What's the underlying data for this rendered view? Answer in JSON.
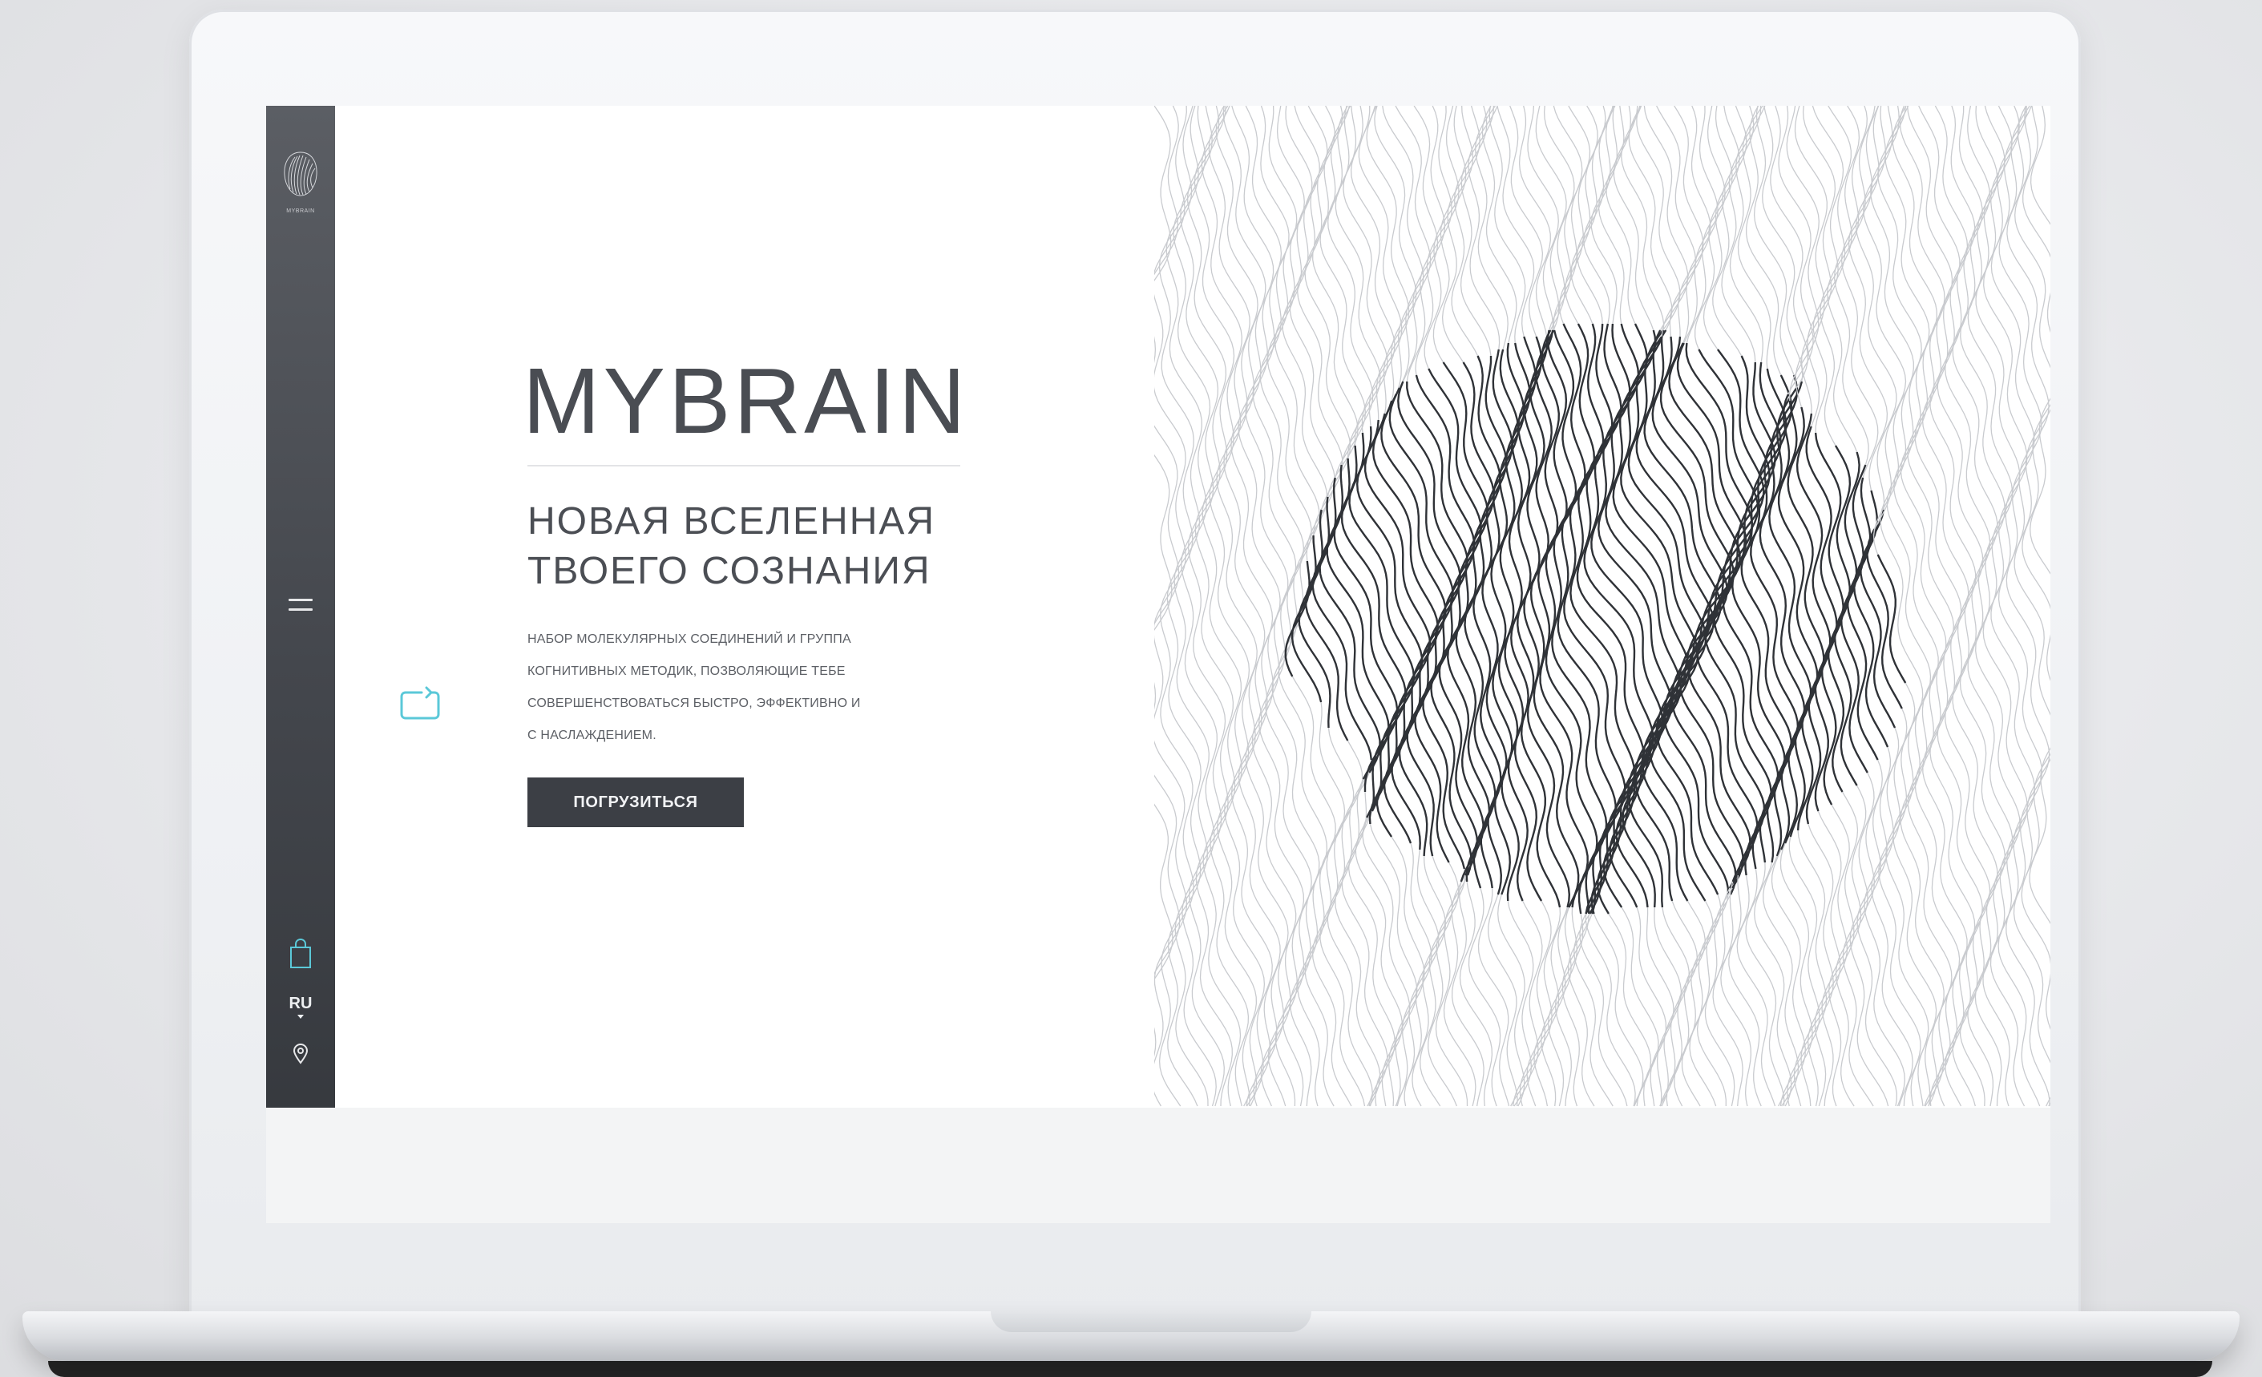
{
  "sidebar": {
    "logo_text": "MYBRAIN",
    "language": "RU"
  },
  "hero": {
    "brand": "MYBRAIN",
    "tagline_line1": "НОВАЯ ВСЕЛЕННАЯ",
    "tagline_line2": "ТВОЕГО СОЗНАНИЯ",
    "description_lines": [
      "НАБОР МОЛЕКУЛЯРНЫХ СОЕДИНЕНИЙ И ГРУППА",
      "КОГНИТИВНЫХ МЕТОДИК, ПОЗВОЛЯЮЩИЕ ТЕБЕ",
      "СОВЕРШЕНСТВОВАТЬСЯ БЫСТРО, ЭФФЕКТИВНО И",
      "С НАСЛАЖДЕНИЕМ."
    ],
    "cta_label": "ПОГРУЗИТЬСЯ"
  },
  "colors": {
    "sidebar_top": "#5b5e64",
    "sidebar_bottom": "#33363b",
    "accent_icon": "#5bc8d8",
    "button_bg": "#3c3f45",
    "text_dark": "#4a4d53"
  },
  "icons": {
    "logo": "fingerprint-brain-icon",
    "menu": "hamburger-icon",
    "cart": "shopping-bag-icon",
    "location": "map-pin-icon",
    "bottom_menu": "double-line-icon",
    "floating": "repeat-cycle-icon"
  }
}
